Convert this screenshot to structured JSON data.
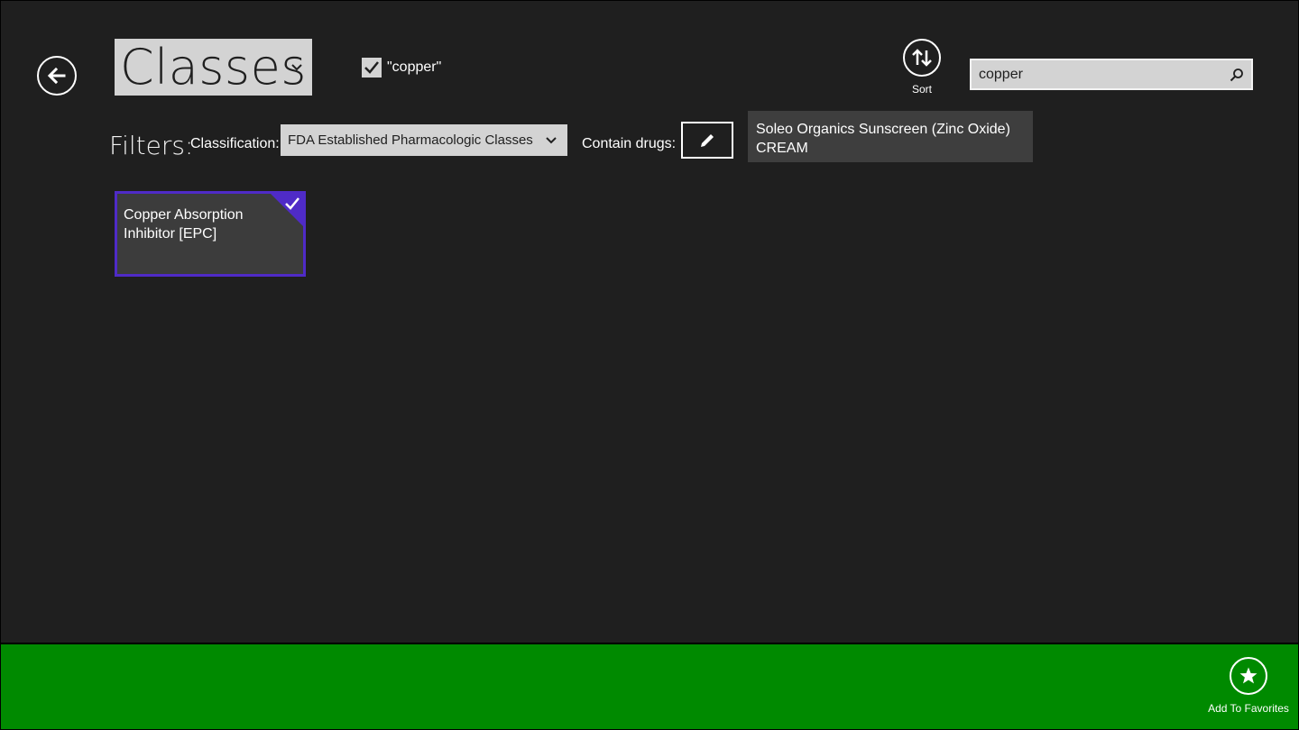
{
  "header": {
    "title": "Classes",
    "search_term_label": "\"copper\"",
    "search_term_checked": true,
    "sort_label": "Sort",
    "search_value": "copper"
  },
  "filters": {
    "label": "Filters:",
    "classification_label": "Classification:",
    "classification_value": "FDA Established Pharmacologic Classes",
    "contain_drugs_label": "Contain drugs:",
    "drug": {
      "line1": "Soleo Organics Sunscreen (Zinc Oxide)",
      "line2": "CREAM"
    }
  },
  "results": [
    {
      "line1": "Copper Absorption",
      "line2": "Inhibitor [EPC]",
      "selected": true
    }
  ],
  "app_bar": {
    "favorites_label": "Add To Favorites"
  },
  "icons": {
    "back": "back-arrow-icon",
    "title_chevron": "chevron-down-icon",
    "checkbox": "checkmark-icon",
    "sort": "sort-arrows-icon",
    "search": "search-icon",
    "edit": "pencil-icon",
    "tile_check": "checkmark-icon",
    "favorites": "star-icon"
  },
  "colors": {
    "background": "#1f1f1f",
    "app_bar": "#008a00",
    "selection_accent": "#4f2bc7",
    "control_fill": "#d3d3d3",
    "chip_fill": "#3e3e3e"
  }
}
